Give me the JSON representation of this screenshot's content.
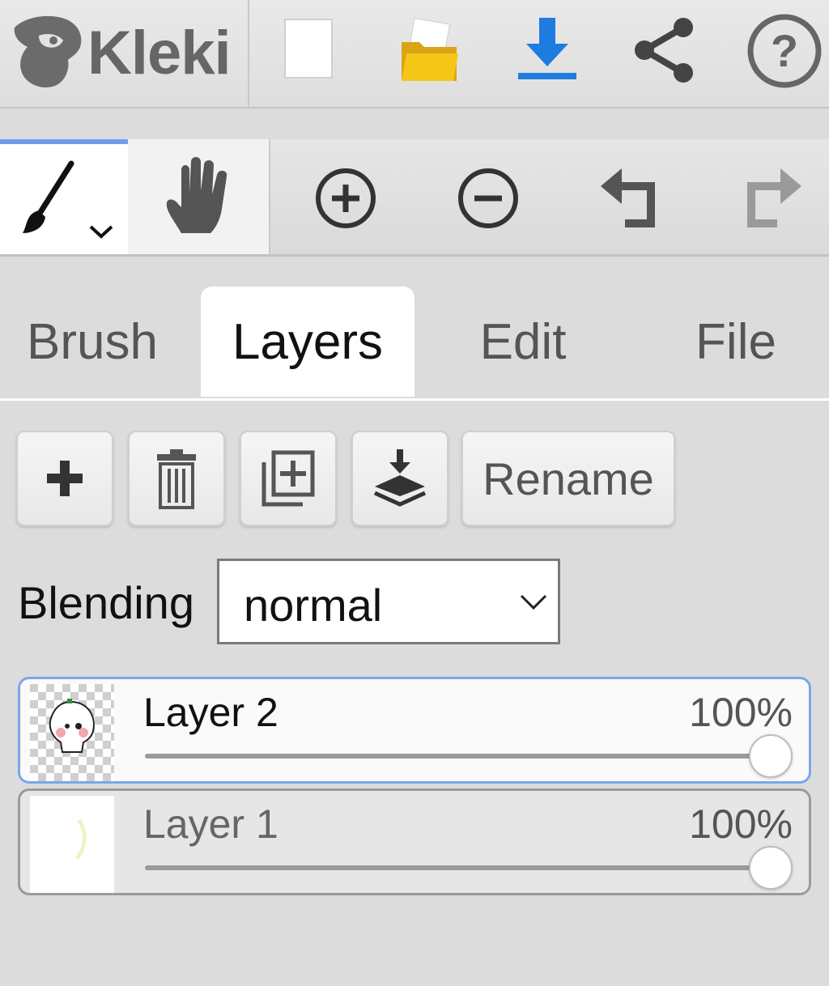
{
  "app": {
    "logo_text": "Kleki",
    "colors": {
      "accent": "#6f9ee8",
      "download": "#1e7ce0",
      "folder": "#f5c518",
      "panel_bg": "#dcdcdc"
    }
  },
  "toolbar_top": {
    "icons": [
      "kleki-logo-icon",
      "new-document-icon",
      "open-folder-icon",
      "download-icon",
      "share-icon",
      "help-icon"
    ]
  },
  "toolbar_tools": {
    "icons": [
      "brush-icon",
      "hand-icon",
      "zoom-in-icon",
      "zoom-out-icon",
      "undo-icon",
      "redo-icon"
    ],
    "active_tool": "brush"
  },
  "tabs": [
    {
      "label": "Brush"
    },
    {
      "label": "Layers"
    },
    {
      "label": "Edit"
    },
    {
      "label": "File"
    }
  ],
  "active_tab": "Layers",
  "layer_actions": {
    "icons": [
      "add-layer-icon",
      "delete-layer-icon",
      "duplicate-layer-icon",
      "merge-down-icon"
    ],
    "rename_label": "Rename"
  },
  "blending": {
    "label": "Blending",
    "value": "normal"
  },
  "layers": [
    {
      "name": "Layer 2",
      "opacity": "100%",
      "opacity_value": 1.0,
      "selected": true
    },
    {
      "name": "Layer 1",
      "opacity": "100%",
      "opacity_value": 1.0,
      "selected": false
    }
  ]
}
